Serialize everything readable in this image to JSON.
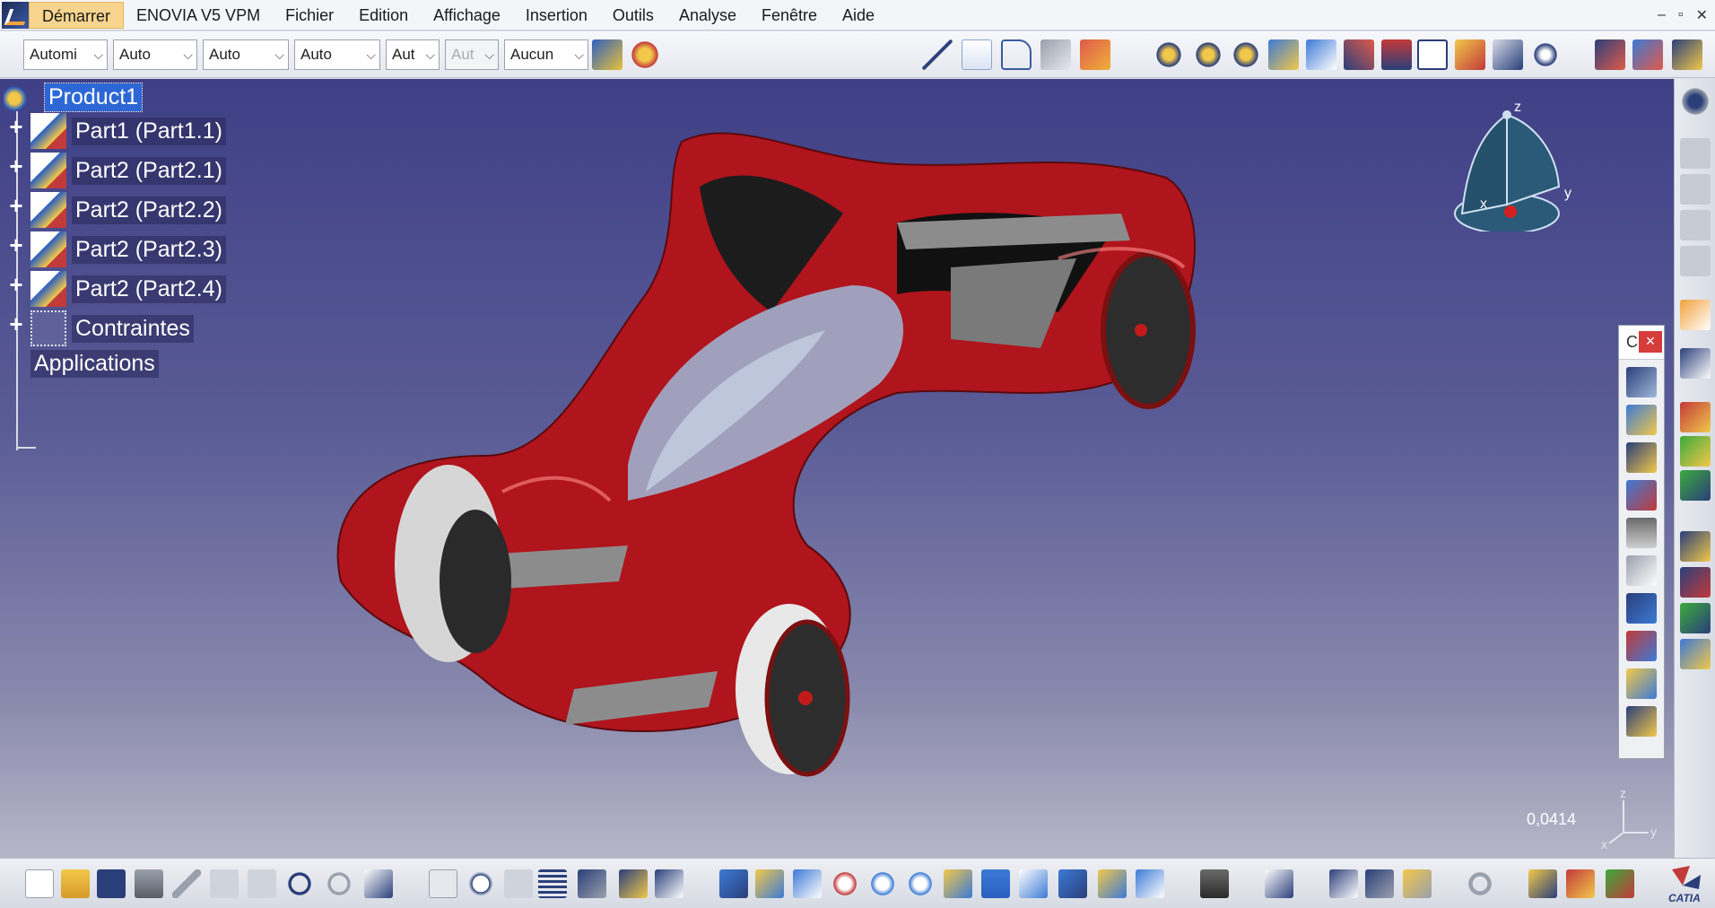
{
  "menubar": {
    "items": [
      "Démarrer",
      "ENOVIA V5 VPM",
      "Fichier",
      "Edition",
      "Affichage",
      "Insertion",
      "Outils",
      "Analyse",
      "Fenêtre",
      "Aide"
    ],
    "window_controls": [
      "–",
      "▫",
      "✕"
    ]
  },
  "toolbar": {
    "combos": [
      {
        "value": "Automi",
        "enabled": true
      },
      {
        "value": "Auto",
        "enabled": true
      },
      {
        "value": "Auto",
        "enabled": true
      },
      {
        "value": "Auto",
        "enabled": true
      },
      {
        "value": "Aut",
        "enabled": true
      },
      {
        "value": "Aut",
        "enabled": false
      },
      {
        "value": "Aucun",
        "enabled": true
      }
    ]
  },
  "tree": {
    "root": "Product1",
    "children": [
      "Part1 (Part1.1)",
      "Part2 (Part2.1)",
      "Part2 (Part2.2)",
      "Part2 (Part2.3)",
      "Part2 (Part2.4)"
    ],
    "constraints": "Contraintes",
    "applications": "Applications"
  },
  "viewport": {
    "zoom_readout": "0,0414",
    "compass_labels": {
      "z": "z",
      "x": "x",
      "y": "y"
    },
    "mini_axes_labels": {
      "z": "z",
      "x": "x",
      "y": "y"
    },
    "model_colors": {
      "body": "#b0141c",
      "glass": "#9fb8d8",
      "dark": "#1c1c1c",
      "grey": "#8c8c8c"
    }
  },
  "floating_toolbar": {
    "title": "C",
    "close": "×"
  },
  "catia_logo": "CATIA"
}
